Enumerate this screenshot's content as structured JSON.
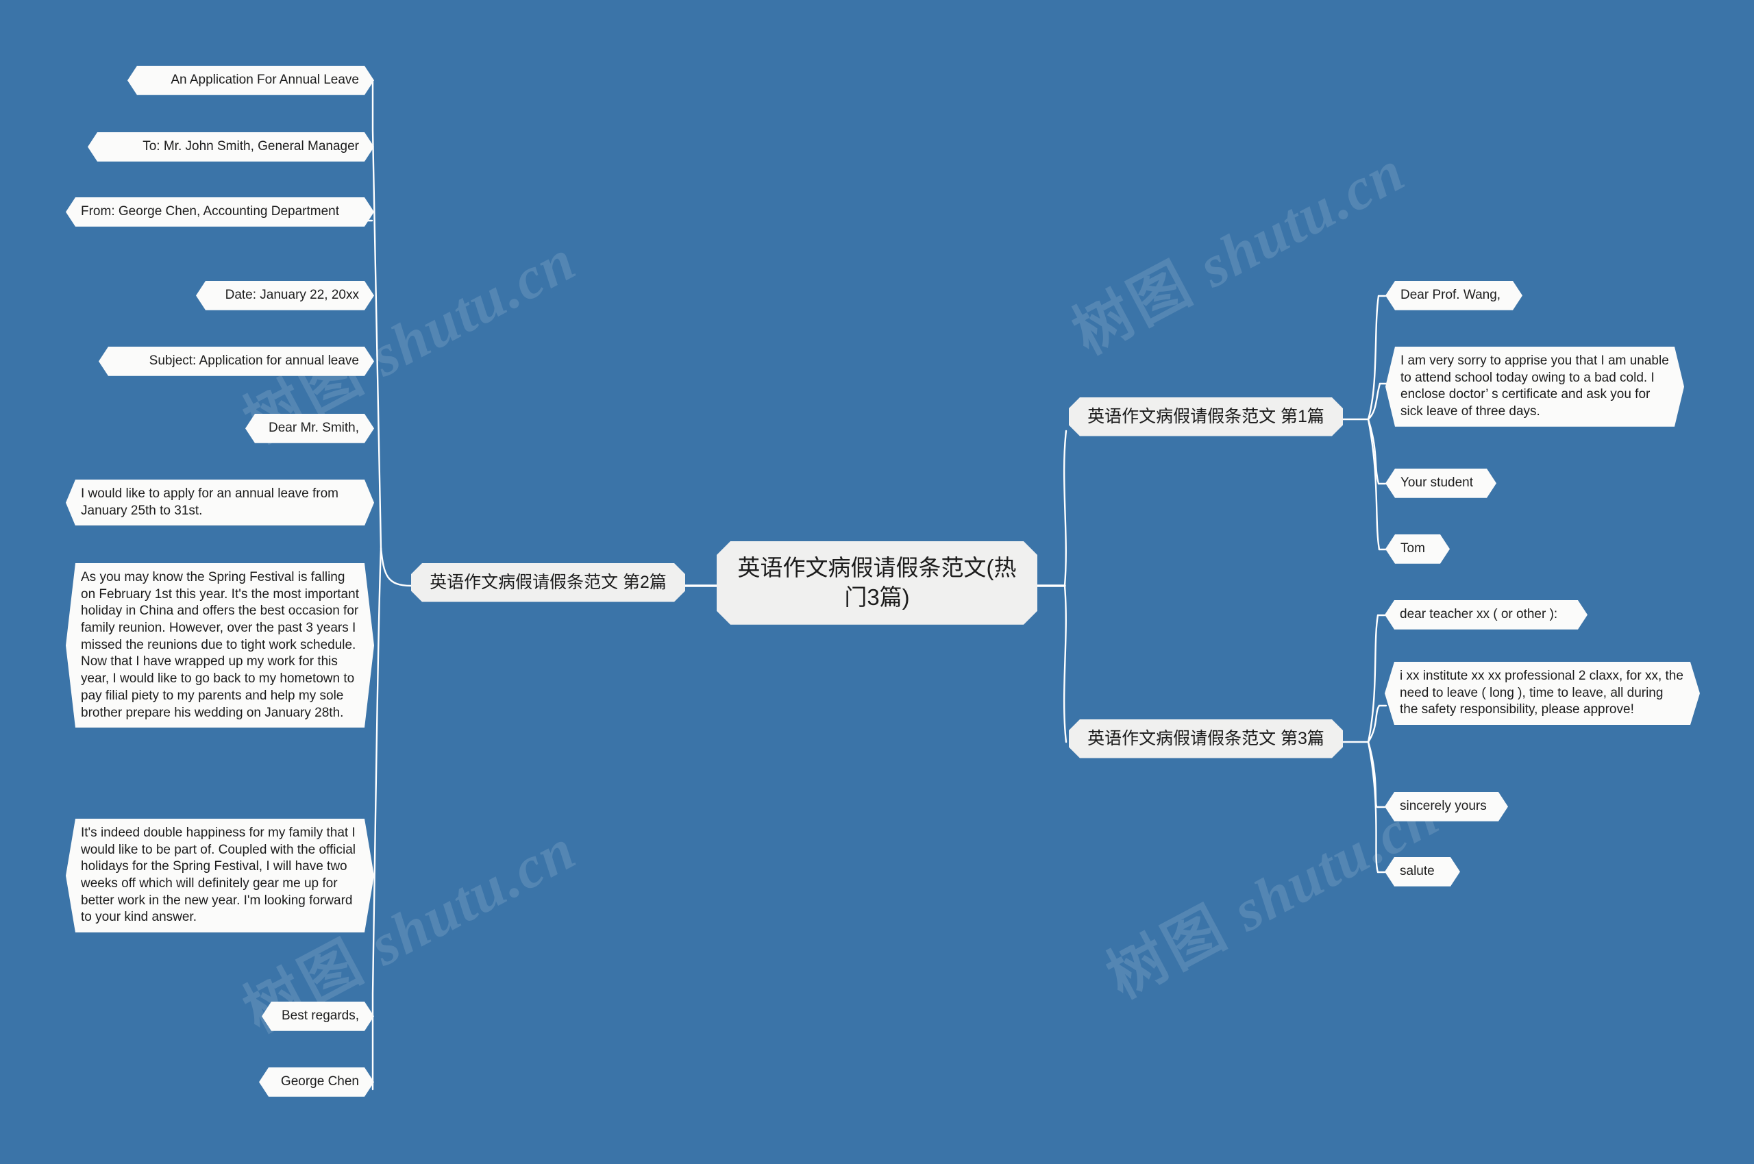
{
  "colors": {
    "background": "#3b74a8",
    "node_fill": "#fbfbfa",
    "topic_fill": "#f0f0ef",
    "connector": "#ffffff",
    "text": "#1c1c1c"
  },
  "watermark": {
    "cjk": "树图",
    "latin": "shutu.cn"
  },
  "root": {
    "label": "英语作文病假请假条范文(热门3篇)"
  },
  "branches": [
    {
      "id": "branch-2",
      "side": "left",
      "label": "英语作文病假请假条范文 第2篇",
      "children": [
        {
          "id": "l1",
          "text": "An Application For Annual Leave"
        },
        {
          "id": "l2",
          "text": "To: Mr. John Smith, General Manager"
        },
        {
          "id": "l3",
          "text": "From: George Chen, Accounting Department"
        },
        {
          "id": "l4",
          "text": "Date: January 22, 20xx"
        },
        {
          "id": "l5",
          "text": "Subject: Application for annual leave"
        },
        {
          "id": "l6",
          "text": "Dear Mr. Smith,"
        },
        {
          "id": "l7",
          "text": "I would like to apply for an annual leave from January 25th to 31st."
        },
        {
          "id": "l8",
          "text": "As you may know the Spring Festival is falling on February 1st this year. It's the most important holiday in China and offers the best occasion for family reunion. However, over the past 3 years I missed the reunions due to tight work schedule. Now that I have wrapped up my work for this year, I would like to go back to my hometown to pay filial piety to my parents and help my sole brother prepare his wedding on January 28th."
        },
        {
          "id": "l9",
          "text": "It's indeed double happiness for my family that I would like to be part of. Coupled with the official holidays for the Spring Festival, I will have two weeks off which will definitely gear me up for better work in the new year. I'm looking forward to your kind answer."
        },
        {
          "id": "l10",
          "text": "Best regards,"
        },
        {
          "id": "l11",
          "text": "George Chen"
        }
      ]
    },
    {
      "id": "branch-1",
      "side": "right",
      "label": "英语作文病假请假条范文 第1篇",
      "children": [
        {
          "id": "r1",
          "text": "Dear Prof. Wang,"
        },
        {
          "id": "r2",
          "text": "I am very sorry to apprise you that I am unable to attend school today owing to a bad cold. I enclose doctor’ s certificate and ask you for sick leave of three days."
        },
        {
          "id": "r3",
          "text": "Your student"
        },
        {
          "id": "r4",
          "text": "Tom"
        }
      ]
    },
    {
      "id": "branch-3",
      "side": "right",
      "label": "英语作文病假请假条范文 第3篇",
      "children": [
        {
          "id": "r5",
          "text": "dear teacher xx ( or other ):"
        },
        {
          "id": "r6",
          "text": "i xx institute xx xx professional 2 claxx, for xx, the need to leave ( long ), time to leave, all during the safety responsibility, please approve!"
        },
        {
          "id": "r7",
          "text": "sincerely yours"
        },
        {
          "id": "r8",
          "text": "salute"
        }
      ]
    }
  ]
}
